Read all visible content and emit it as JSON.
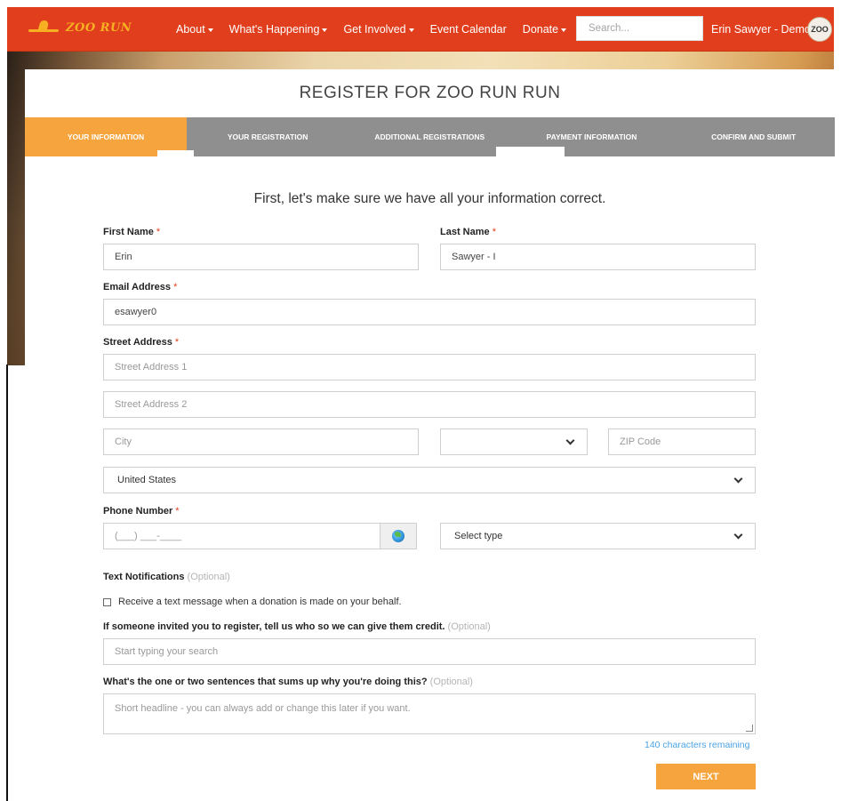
{
  "header": {
    "logo_text": "ZOO RUN",
    "nav": [
      {
        "label": "About",
        "dropdown": true
      },
      {
        "label": "What's Happening",
        "dropdown": true
      },
      {
        "label": "Get Involved",
        "dropdown": true
      },
      {
        "label": "Event Calendar",
        "dropdown": false
      },
      {
        "label": "Donate",
        "dropdown": true
      }
    ],
    "search_placeholder": "Search...",
    "user_name": "Erin Sawyer - Demo",
    "avatar_text": "ZOO"
  },
  "page": {
    "title": "REGISTER FOR ZOO RUN RUN",
    "intro": "First, let's make sure we have all your information correct."
  },
  "steps": [
    {
      "label": "YOUR INFORMATION",
      "active": true
    },
    {
      "label": "YOUR REGISTRATION",
      "active": false
    },
    {
      "label": "ADDITIONAL REGISTRATIONS",
      "active": false
    },
    {
      "label": "PAYMENT INFORMATION",
      "active": false
    },
    {
      "label": "CONFIRM AND SUBMIT",
      "active": false
    }
  ],
  "form": {
    "first_name": {
      "label": "First Name",
      "required_mark": "*",
      "value": "Erin"
    },
    "last_name": {
      "label": "Last Name",
      "required_mark": "*",
      "value": "Sawyer - I"
    },
    "email": {
      "label": "Email Address",
      "required_mark": "*",
      "value": "esawyer0"
    },
    "street": {
      "label": "Street Address",
      "required_mark": "*",
      "line1_placeholder": "Street Address 1",
      "line2_placeholder": "Street Address 2",
      "city_placeholder": "City",
      "state_value": "",
      "zip_placeholder": "ZIP Code",
      "country_value": "United States"
    },
    "phone": {
      "label": "Phone Number",
      "required_mark": "*",
      "placeholder": "(___) ___-____",
      "type_value": "Select type"
    },
    "text_notifications": {
      "label": "Text Notifications",
      "optional": "(Optional)",
      "checkbox_label": "Receive a text message when a donation is made on your behalf."
    },
    "invited_by": {
      "label": "If someone invited you to register, tell us who so we can give them credit.",
      "optional": "(Optional)",
      "placeholder": "Start typing your search"
    },
    "headline": {
      "label": "What's the one or two sentences that sums up why you're doing this?",
      "optional": "(Optional)",
      "placeholder": "Short headline - you can always add or change this later if you want.",
      "chars_remaining": "140 characters remaining"
    },
    "next_label": "NEXT"
  },
  "colors": {
    "header_bg": "#e03e1c",
    "accent": "#f6a53e",
    "step_bg": "#8f8f8f",
    "required": "#e03e1c",
    "link": "#4ba3e3"
  }
}
